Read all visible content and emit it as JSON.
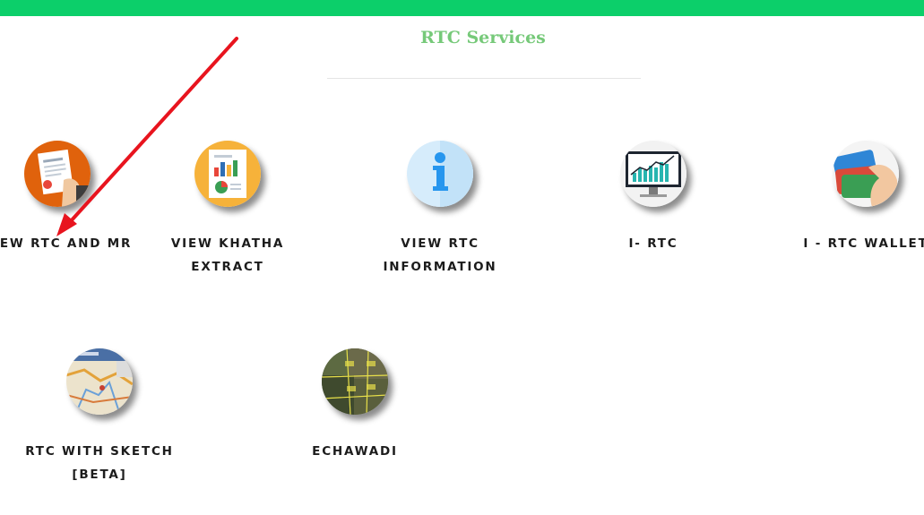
{
  "page": {
    "title": "RTC Services"
  },
  "services": [
    {
      "label": "VIEW RTC AND MR",
      "icon": "document-hand-icon"
    },
    {
      "label": "VIEW KHATHA EXTRACT",
      "icon": "report-chart-icon"
    },
    {
      "label": "VIEW RTC INFORMATION",
      "icon": "info-icon"
    },
    {
      "label": "I- RTC",
      "icon": "monitor-chart-icon"
    },
    {
      "label": "I - RTC WALLET",
      "icon": "wallet-cards-icon"
    },
    {
      "label": "RTC WITH SKETCH [BETA]",
      "icon": "map-icon"
    },
    {
      "label": "ECHAWADI",
      "icon": "land-parcel-map-icon"
    }
  ],
  "colors": {
    "top_bar": "#0ccf6a",
    "title": "#76c979",
    "annotation_arrow": "#e8141e"
  }
}
